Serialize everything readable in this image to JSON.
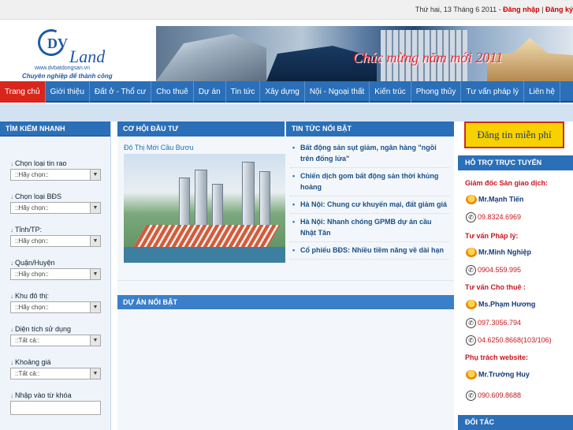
{
  "topbar": {
    "date": "Thứ hai, 13 Tháng 6 2011 - ",
    "login": "Đăng nhập",
    "register": "Đăng ký"
  },
  "logo": {
    "dv": "DV",
    "land": "Land",
    "url": "www.dvbatdongsan.vn",
    "slogan": "Chuyên nghiệp để thành công"
  },
  "banner": {
    "greeting": "Chúc mừng năm mới 2011"
  },
  "nav": [
    "Trang chủ",
    "Giới thiệu",
    "Đất ở - Thổ cư",
    "Cho thuê",
    "Dự án",
    "Tin tức",
    "Xây dựng",
    "Nội - Ngoại thất",
    "Kiến trúc",
    "Phong thủy",
    "Tư vấn pháp lý",
    "Liên hệ"
  ],
  "search": {
    "title": "TÌM KIẾM NHANH",
    "fields": [
      {
        "label": "Chọn loại tin rao",
        "value": "::Hãy chọn::"
      },
      {
        "label": "Chọn loại BĐS",
        "value": "::Hãy chọn::"
      },
      {
        "label": "Tỉnh/TP:",
        "value": "::Hãy chọn::"
      },
      {
        "label": "Quận/Huyện",
        "value": "::Hãy chọn::"
      },
      {
        "label": "Khu đô thị:",
        "value": "::Hãy chọn::"
      },
      {
        "label": "Diện tích sử dụng",
        "value": "::Tất cả::"
      },
      {
        "label": "Khoảng giá",
        "value": "::Tất cả::"
      }
    ],
    "keyword_label": "Nhập vào từ khóa"
  },
  "opportunity": {
    "title": "CƠ HỘI ĐẦU TƯ",
    "project": "Đô Thị Mới Cầu Bươu"
  },
  "news": {
    "title": "TIN TỨC NỔI BẬT",
    "items": [
      "Bất động sản sụt giảm, ngân hàng \"ngồi trên đống lửa\"",
      "Chiến dịch gom bất động sản thời khủng hoảng",
      "Hà Nội: Chung cư khuyến mại, đất giảm giá",
      "Hà Nội: Nhanh chóng GPMB dự án cầu Nhật Tân",
      "Cổ phiếu BĐS: Nhiều tiềm năng về dài hạn"
    ]
  },
  "projects": {
    "title": "DỰ ÁN NỔI BẬT"
  },
  "sidebar": {
    "post_button": "Đăng tin miễn phí",
    "support_title": "HỖ TRỢ TRỰC TUYẾN",
    "roles": [
      "Giám đốc Sàn giao dịch:",
      "Tư vấn Pháp lý:",
      "Tư vấn Cho thuê :",
      "Phụ trách website:"
    ],
    "persons": [
      "Mr.Mạnh Tiến",
      "Mr.Minh Nghiệp",
      "Ms.Phạm Hương",
      "Mr.Trường Huy"
    ],
    "phones": [
      "09.8324.6969",
      "0904.559.995",
      "097.3056.794",
      "04.6250.8668(103/106)",
      "090.609.8688"
    ],
    "partners_title": "ĐỐI TÁC"
  }
}
